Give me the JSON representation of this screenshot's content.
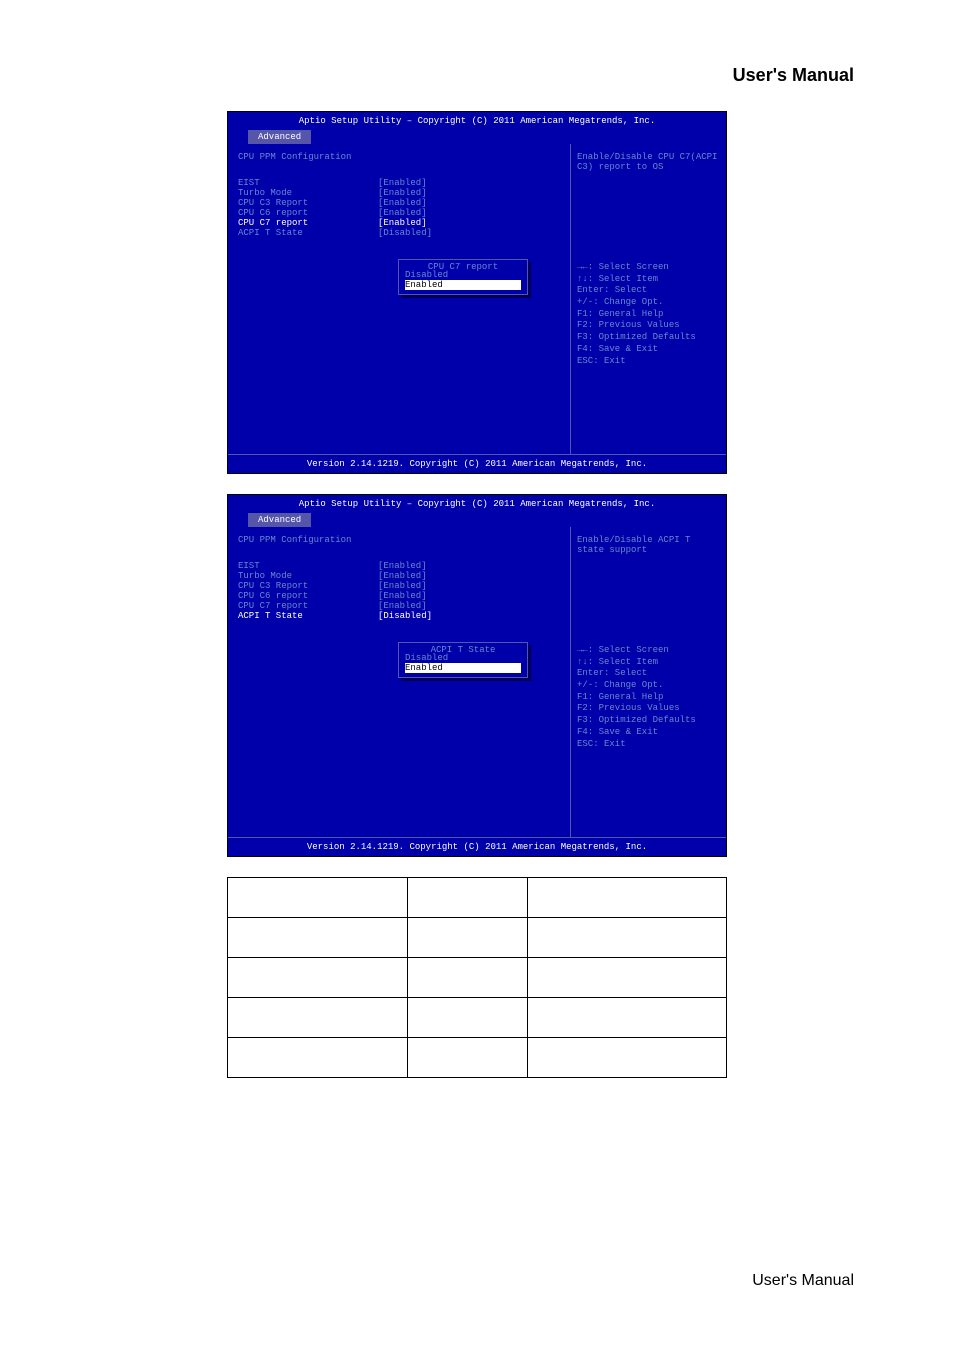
{
  "header_title": "User's Manual",
  "bios": {
    "header": "Aptio Setup Utility – Copyright (C) 2011 American Megatrends, Inc.",
    "tab": "Advanced",
    "section_title": "CPU PPM Configuration",
    "footer": "Version 2.14.1219. Copyright (C) 2011 American Megatrends, Inc.",
    "items": [
      {
        "label": "EIST",
        "value": "[Enabled]"
      },
      {
        "label": "Turbo Mode",
        "value": "[Enabled]"
      },
      {
        "label": "CPU C3 Report",
        "value": "[Enabled]"
      },
      {
        "label": "CPU C6 report",
        "value": "[Enabled]"
      },
      {
        "label": "CPU C7 report",
        "value": "[Enabled]"
      },
      {
        "label": "ACPI T State",
        "value": "[Disabled]"
      }
    ],
    "help_keys": [
      "→←: Select Screen",
      "↑↓: Select Item",
      "Enter: Select",
      "+/-: Change Opt.",
      "F1: General Help",
      "F2: Previous Values",
      "F3: Optimized Defaults",
      "F4: Save & Exit",
      "ESC: Exit"
    ]
  },
  "screen1": {
    "help_text": "Enable/Disable CPU C7(ACPI C3) report to OS",
    "popup_title": "CPU C7 report",
    "popup_options": [
      "Disabled",
      "Enabled"
    ],
    "selected_item_index": 4,
    "popup_selected_index": 1
  },
  "screen2": {
    "help_text": "Enable/Disable ACPI T state support",
    "popup_title": "ACPI T State",
    "popup_options": [
      "Disabled",
      "Enabled"
    ],
    "selected_item_index": 5,
    "popup_selected_index": 1
  },
  "footer_text": "User's Manual"
}
